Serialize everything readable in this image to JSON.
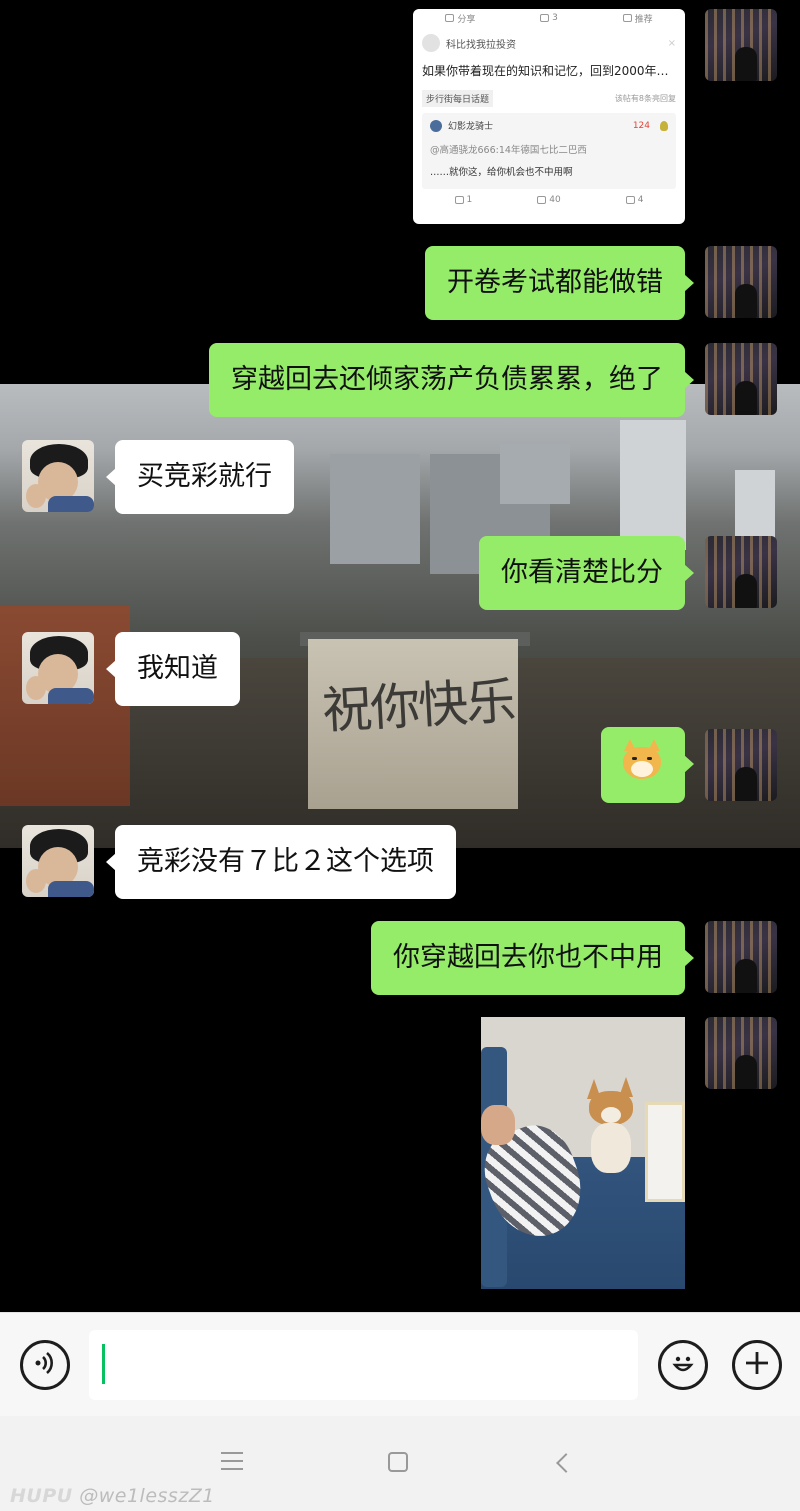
{
  "shared_card": {
    "top_actions": [
      {
        "icon": "share-icon",
        "label": "分享"
      },
      {
        "icon": "comment-icon",
        "label": "3"
      },
      {
        "icon": "thumbs-up-icon",
        "label": "推荐"
      }
    ],
    "author": "科比找我拉投资",
    "close": "×",
    "title": "如果你带着现在的知识和记忆，回到2000年…",
    "topic_tag": "步行街每日话题",
    "meta": "该帖有8条亮回复",
    "reply": {
      "name": "幻影龙骑士",
      "lights": "124",
      "quote": "@高通骁龙666:14年德国七比二巴西",
      "text": "……就你这，给你机会也不中用啊"
    },
    "bottom_actions": [
      {
        "icon": "share-icon",
        "label": "1"
      },
      {
        "icon": "comment-icon",
        "label": "40"
      },
      {
        "icon": "thumbs-up-icon",
        "label": "4"
      }
    ]
  },
  "messages": [
    {
      "side": "self",
      "text": "开卷考试都能做错"
    },
    {
      "side": "self",
      "text": "穿越回去还倾家荡产负债累累，绝了"
    },
    {
      "side": "other",
      "text": "买竞彩就行"
    },
    {
      "side": "self",
      "text": "你看清楚比分"
    },
    {
      "side": "other",
      "text": "我知道"
    },
    {
      "side": "self",
      "sticker": "doge-sticker"
    },
    {
      "side": "other",
      "text": "竞彩没有７比２这个选项"
    },
    {
      "side": "self",
      "text": "你穿越回去你也不中用"
    },
    {
      "side": "self",
      "image": "corgi-photo"
    }
  ],
  "wallpaper_text": "祝你快乐",
  "input_bar": {
    "voice_icon": "voice-icon",
    "placeholder": "",
    "emoji_icon": "emoji-icon",
    "plus_icon": "plus-icon"
  },
  "nav": {
    "menu": "menu-icon",
    "home": "home-icon",
    "back": "back-icon"
  },
  "watermark": {
    "brand": "HUPU",
    "user": "@we1lesszZ1"
  },
  "colors": {
    "self_bubble": "#95ec69",
    "other_bubble": "#ffffff",
    "caret": "#07c160"
  }
}
